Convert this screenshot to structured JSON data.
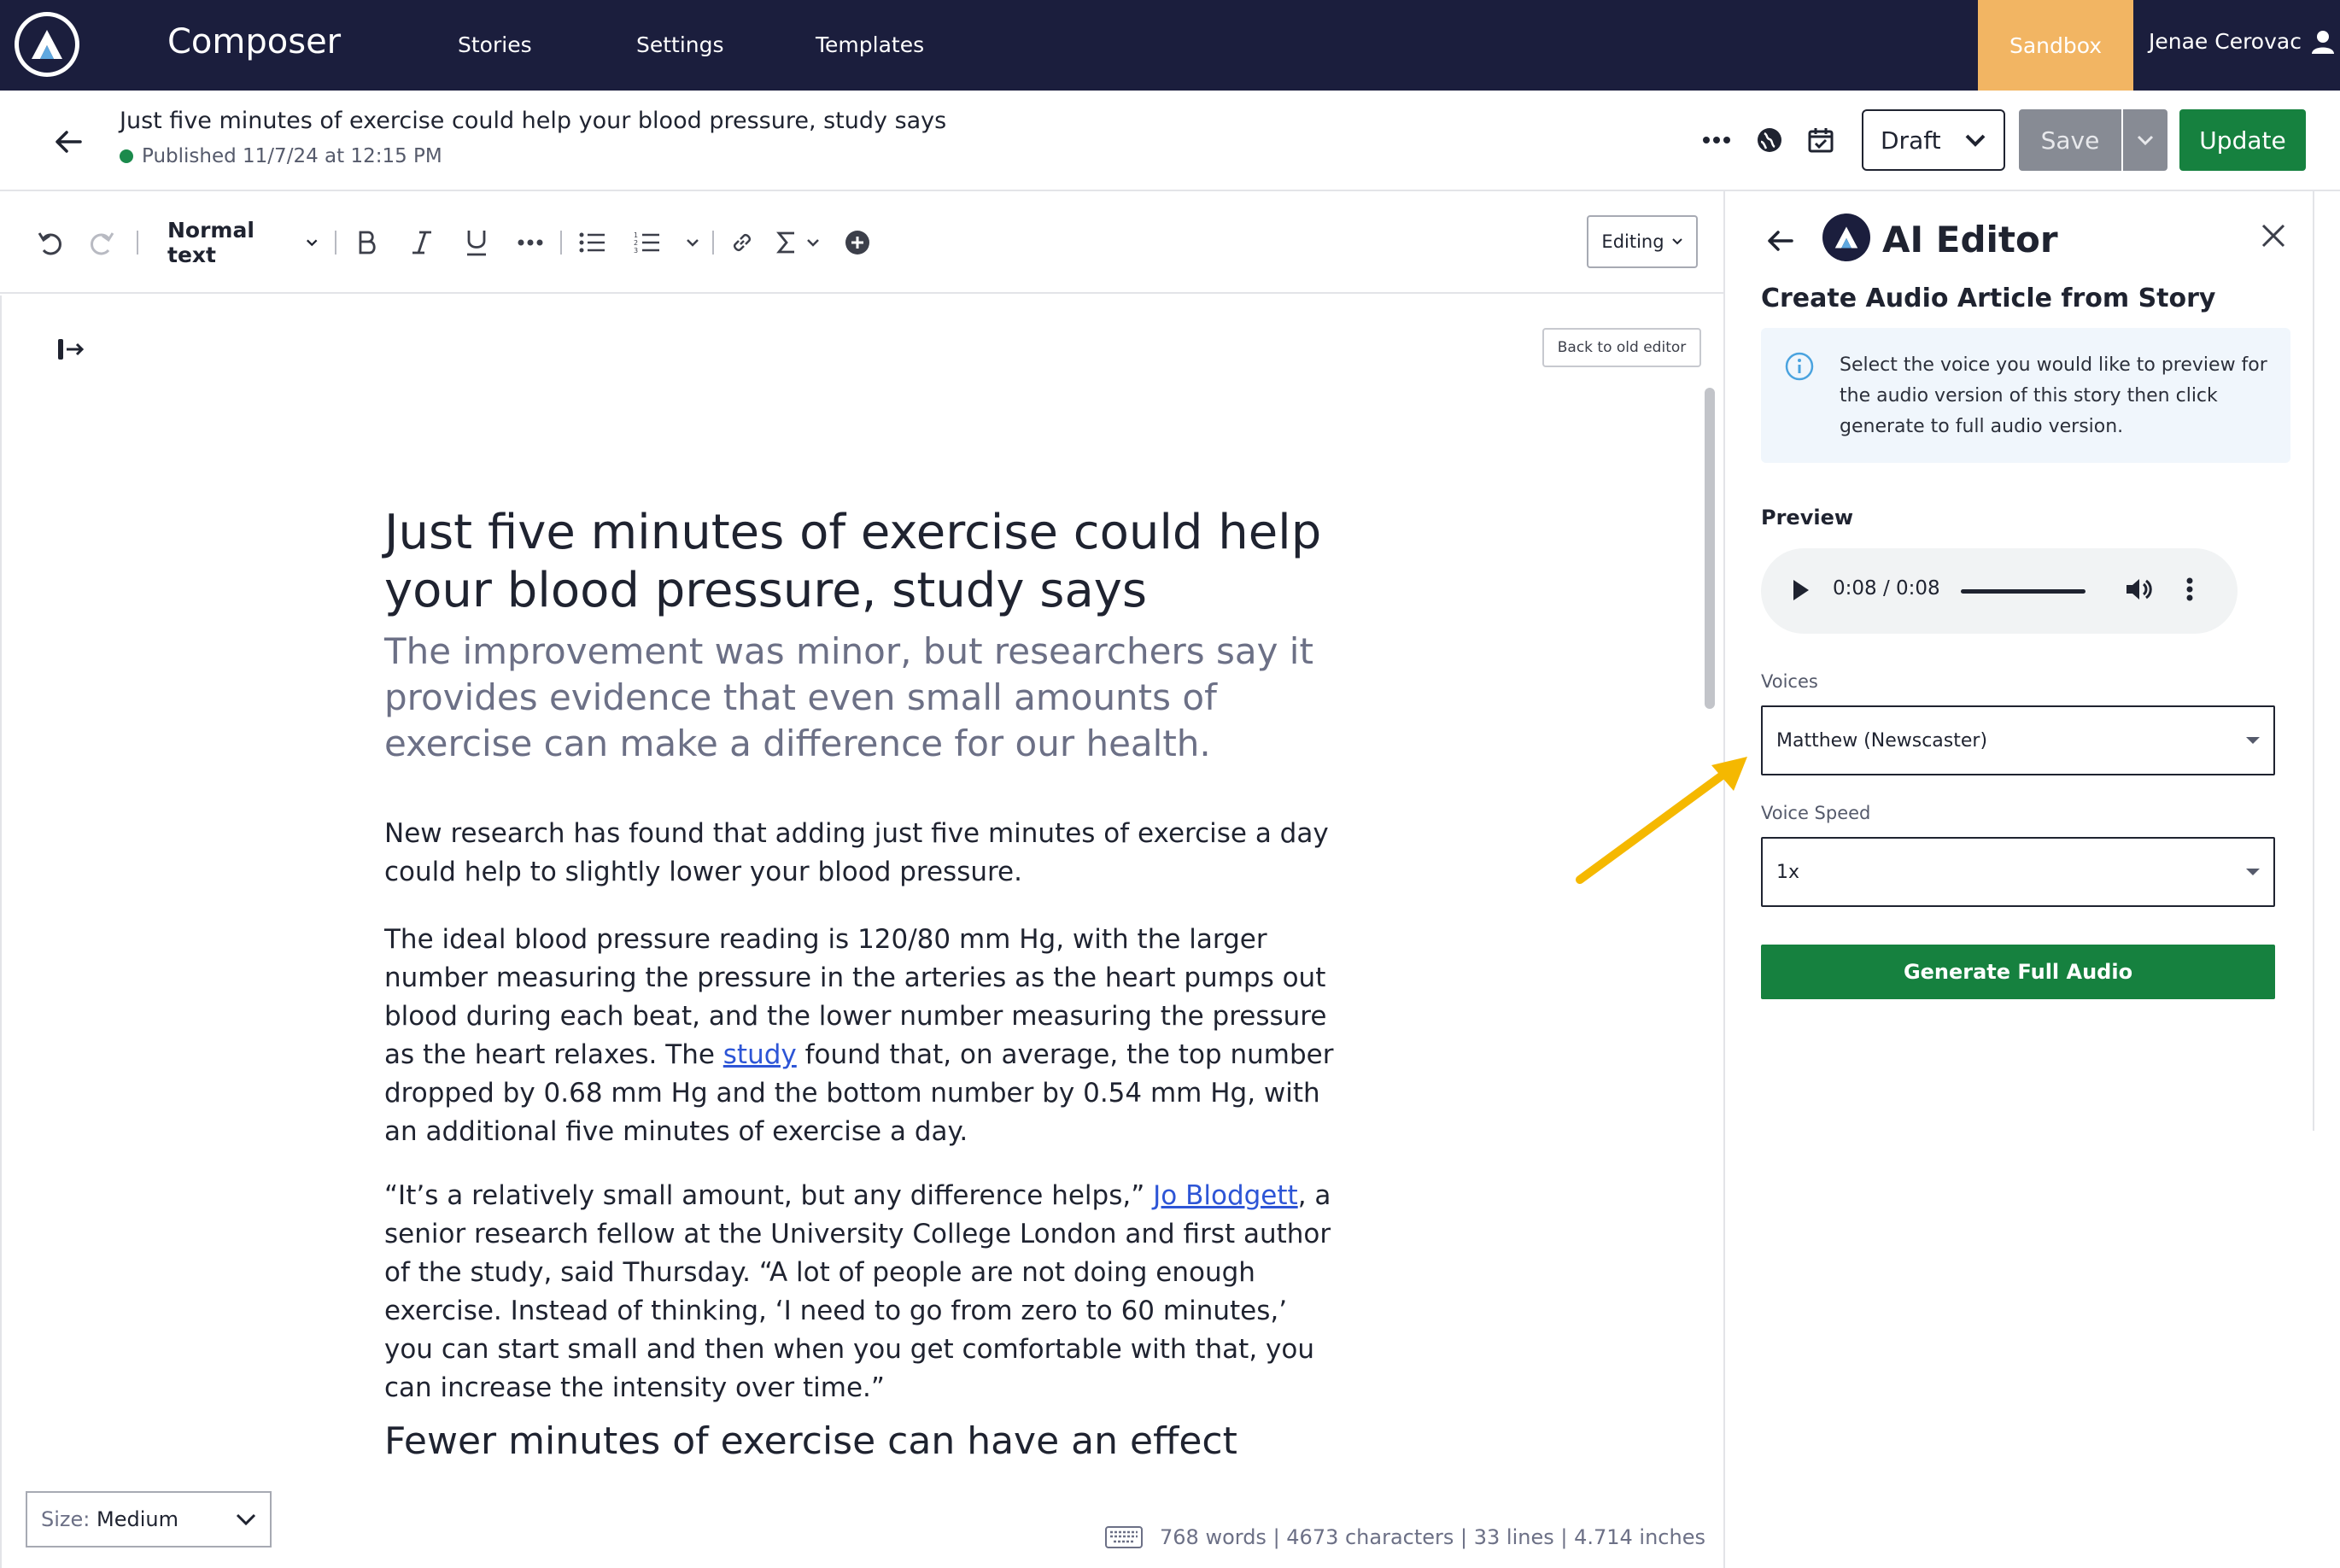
{
  "app": {
    "name": "Composer",
    "nav": [
      "Stories",
      "Settings",
      "Templates"
    ],
    "env_badge": "Sandbox",
    "user_name": "Jenae Cerovac"
  },
  "story_header": {
    "title": "Just five minutes of exercise could help your blood pressure, study says",
    "status": "Published 11/7/24 at 12:15 PM",
    "status_selector": "Draft",
    "save_label": "Save",
    "update_label": "Update"
  },
  "toolbar": {
    "text_style": "Normal text",
    "mode": "Editing"
  },
  "editor": {
    "old_editor_label": "Back to old editor",
    "headline": "Just five minutes of exercise could help your blood pressure, study says",
    "dek": "The improvement was minor, but researchers say it provides evidence that even small amounts of exercise can make a difference for our health.",
    "paragraphs": {
      "p1": "New research has found that adding just five minutes of exercise a day could help to slightly lower your blood pressure.",
      "p2_before": "The ideal blood pressure reading is 120/80 mm Hg, with the larger number measuring the pressure in the arteries as the heart pumps out blood during each beat, and the lower number measuring the pressure as the heart relaxes. The ",
      "p2_link": "study",
      "p2_after": " found that, on average, the top number dropped by 0.68 mm Hg and the bottom number by 0.54 mm Hg, with an additional five minutes of exercise a day.",
      "p3_before": "“It’s a relatively small amount, but any difference helps,” ",
      "p3_link": "Jo Blodgett",
      "p3_after": ", a senior research fellow at the University College London and first author of the study, said Thursday. “A lot of people are not doing enough exercise. Instead of thinking, ‘I need to go from zero to 60 minutes,’ you can start small and then when you get comfortable with that, you can increase the intensity over time.”"
    },
    "subhead": "Fewer minutes of exercise can have an effect",
    "size_label": "Size:",
    "size_value": "Medium",
    "stats": "768 words | 4673 characters | 33 lines | 4.714 inches"
  },
  "ai_panel": {
    "title": "AI Editor",
    "subtitle": "Create Audio Article from Story",
    "info": "Select the voice you would like to preview for the audio version of this story then click generate to full audio version.",
    "preview_label": "Preview",
    "audio_time": "0:08 / 0:08",
    "audio_progress": 1.0,
    "voices_label": "Voices",
    "voice_value": "Matthew (Newscaster)",
    "speed_label": "Voice Speed",
    "speed_value": "1x",
    "generate_label": "Generate Full Audio"
  },
  "colors": {
    "nav_bg": "#1b1e3d",
    "sandbox": "#f2b563",
    "primary_green": "#16813f",
    "link": "#2d55d6",
    "annotation_arrow": "#f5b800"
  }
}
